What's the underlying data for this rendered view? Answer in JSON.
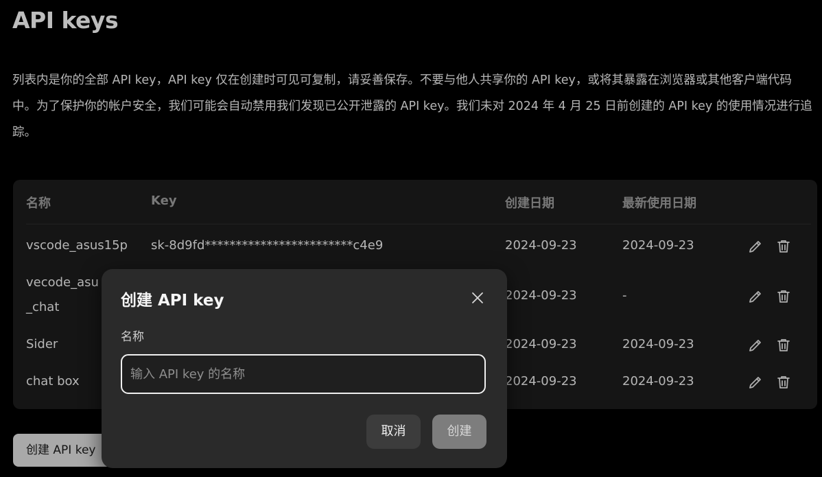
{
  "page": {
    "title": "API keys",
    "description": "列表内是你的全部 API key，API key 仅在创建时可见可复制，请妥善保存。不要与他人共享你的 API key，或将其暴露在浏览器或其他客户端代码中。为了保护你的帐户安全，我们可能会自动禁用我们发现已公开泄露的 API key。我们未对 2024 年 4 月 25 日前创建的 API key 的使用情况进行追踪。"
  },
  "table": {
    "headers": {
      "name": "名称",
      "key": "Key",
      "created": "创建日期",
      "last_used": "最新使用日期"
    },
    "rows": [
      {
        "name": "vscode_asus15p",
        "key": "sk-8d9fd************************c4e9",
        "created": "2024-09-23",
        "last_used": "2024-09-23"
      },
      {
        "name_line1": "vecode_asu",
        "name_line2": "_chat",
        "created": "2024-09-23",
        "last_used": "-"
      },
      {
        "name": "Sider",
        "created": "2024-09-23",
        "last_used": "2024-09-23"
      },
      {
        "name": "chat box",
        "created": "2024-09-23",
        "last_used": "2024-09-23"
      }
    ],
    "row_icons": [
      "pencil-icon",
      "trash-icon"
    ]
  },
  "create_button": {
    "label": "创建 API key"
  },
  "modal": {
    "title": "创建 API key",
    "field_label": "名称",
    "input_value": "",
    "input_placeholder": "输入 API key 的名称",
    "cancel_label": "取消",
    "create_label": "创建",
    "close_icon": "close-icon"
  },
  "colors": {
    "background": "#000000",
    "card": "#1c1c1c",
    "modal": "#2a2a2a",
    "primary_disabled": "#7d7d7d"
  }
}
